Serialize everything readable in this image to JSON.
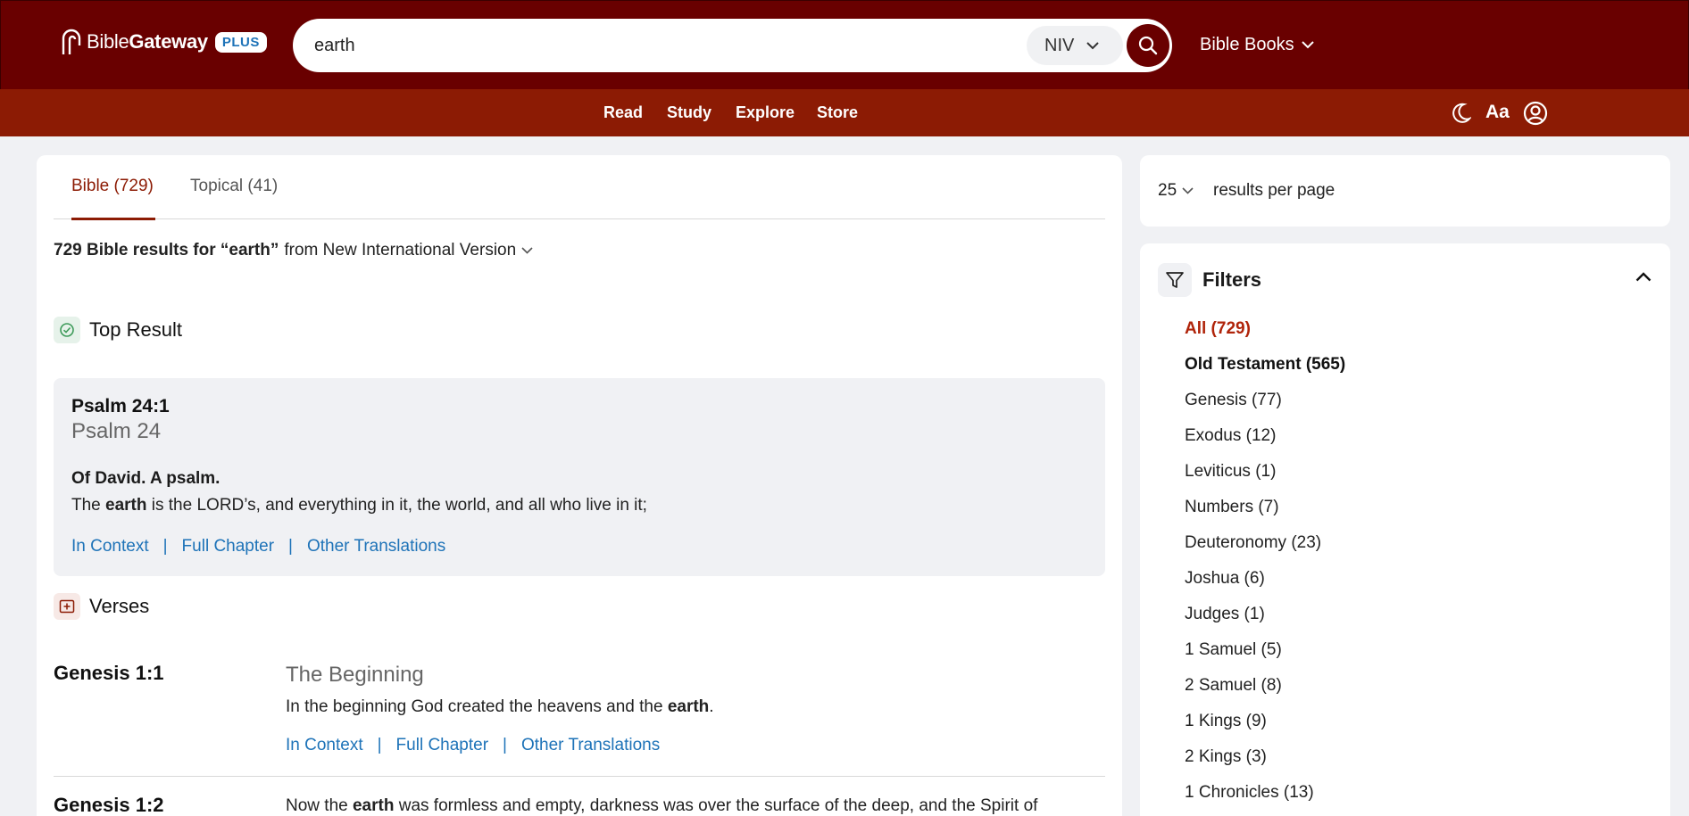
{
  "header": {
    "logo_text_light": "Bible",
    "logo_text_bold": "Gateway",
    "plus_badge": "PLUS",
    "search_value": "earth",
    "version": "NIV",
    "bible_books": "Bible Books"
  },
  "nav": {
    "items": [
      "Read",
      "Study",
      "Explore",
      "Store"
    ],
    "font_size_label": "Aa"
  },
  "tabs": [
    {
      "label": "Bible (729)"
    },
    {
      "label": "Topical (41)"
    }
  ],
  "results": {
    "summary_bold": "729 Bible results for “earth”",
    "summary_rest": "from New International Version"
  },
  "top_result": {
    "section_label": "Top Result",
    "reference": "Psalm 24:1",
    "chapter_title": "Psalm 24",
    "heading": "Of David. A psalm.",
    "text_pre": "The ",
    "text_keyword": "earth",
    "text_mid": " is the L",
    "text_lord_small": "ORD",
    "text_post": "’s, and everything in it, the world, and all who live in it;"
  },
  "links": {
    "in_context": "In Context",
    "full_chapter": "Full Chapter",
    "other_translations": "Other Translations",
    "separator": "|"
  },
  "verses": {
    "section_label": "Verses",
    "items": [
      {
        "reference": "Genesis 1:1",
        "title": "The Beginning",
        "text_pre": "In the beginning God created the heavens and the ",
        "text_keyword": "earth",
        "text_post": "."
      },
      {
        "reference": "Genesis 1:2",
        "text_pre": "Now the ",
        "text_keyword": "earth",
        "text_post": " was formless and empty, darkness was over the surface of the deep, and the Spirit of"
      }
    ]
  },
  "results_per_page": {
    "value": "25",
    "label": "results per page"
  },
  "filters": {
    "title": "Filters",
    "items": [
      {
        "label": "All (729)"
      },
      {
        "label": "Old Testament (565)"
      },
      {
        "label": "Genesis (77)"
      },
      {
        "label": "Exodus (12)"
      },
      {
        "label": "Leviticus (1)"
      },
      {
        "label": "Numbers (7)"
      },
      {
        "label": "Deuteronomy (23)"
      },
      {
        "label": "Joshua (6)"
      },
      {
        "label": "Judges (1)"
      },
      {
        "label": "1 Samuel (5)"
      },
      {
        "label": "2 Samuel (8)"
      },
      {
        "label": "1 Kings (9)"
      },
      {
        "label": "2 Kings (3)"
      },
      {
        "label": "1 Chronicles (13)"
      }
    ]
  },
  "colors": {
    "header_bg": "#690000",
    "nav_bg": "#8c1b04",
    "link": "#1e73b8",
    "active_filter": "#b0240a"
  }
}
